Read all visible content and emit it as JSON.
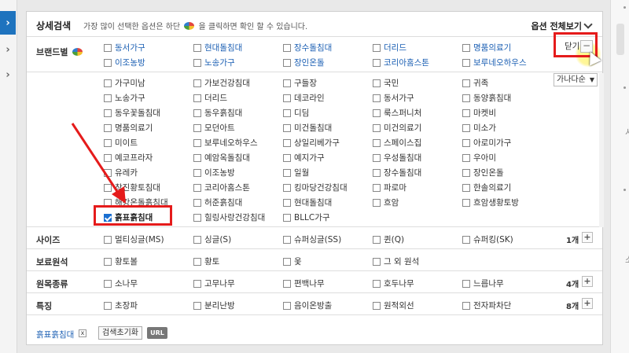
{
  "left_tabs": [
    "›",
    "›",
    "›"
  ],
  "right_strip": {
    "chars": [
      "시",
      "소"
    ]
  },
  "header": {
    "title": "상세검색",
    "desc_before": "가장 많이 선택한 옵션은 하단",
    "desc_after": "을 클릭하면 확인 할 수 있습니다.",
    "options_all": "옵션 전체보기"
  },
  "brand": {
    "label": "브랜드별",
    "favorites": [
      "동서가구",
      "현대돌침대",
      "장수돌침대",
      "더리드",
      "명품의료기",
      "이조농방",
      "노송가구",
      "장인온돌",
      "코리아홈스톤",
      "보루네오하우스"
    ],
    "close_label": "닫기",
    "minus": "−",
    "sort": "가나다순",
    "sort_arrow": "▼",
    "all": [
      [
        "가구미남",
        "가보건강침대",
        "구들장",
        "국민",
        "귀족"
      ],
      [
        "노송가구",
        "더리드",
        "데코라인",
        "동서가구",
        "동양흙침대"
      ],
      [
        "동우꽃돌침대",
        "동우흙침대",
        "디딤",
        "룩스퍼니처",
        "마켓비"
      ],
      [
        "명품의료기",
        "모던아트",
        "미건돌침대",
        "미건의료기",
        "미소가"
      ],
      [
        "미이트",
        "보루네오하우스",
        "상일리베가구",
        "스페이스집",
        "아로미가구"
      ],
      [
        "예코프라자",
        "예암옥돌침대",
        "예지가구",
        "우성돌침대",
        "우아미"
      ],
      [
        "유레카",
        "이조농방",
        "일월",
        "장수돌침대",
        "장인온돌"
      ],
      [
        "참진황토침대",
        "코리아홈스톤",
        "킹마당건강침대",
        "파로마",
        "한솔의료기"
      ],
      [
        "해강온돌흙침대",
        "허준흙침대",
        "현대돌침대",
        "흐암",
        "흐암생황토방"
      ],
      [
        "흙표흙침대",
        "힐링사랑건강침대",
        "BLLC가구",
        "",
        ""
      ]
    ],
    "checked": "흙표흙침대"
  },
  "sections": [
    {
      "label": "사이즈",
      "options": [
        "멀티싱글(MS)",
        "싱글(S)",
        "슈퍼싱글(SS)",
        "퀸(Q)",
        "슈퍼킹(SK)"
      ],
      "count": "1개",
      "plus": "+"
    },
    {
      "label": "보료원석",
      "options": [
        "황토볼",
        "황토",
        "옻",
        "그 외 원석"
      ],
      "count": "",
      "plus": ""
    },
    {
      "label": "원목종류",
      "options": [
        "소나무",
        "고무나무",
        "편백나무",
        "호두나무",
        "느릅나무"
      ],
      "count": "4개",
      "plus": "+"
    },
    {
      "label": "특징",
      "options": [
        "초장파",
        "분리난방",
        "음이온방출",
        "원적외선",
        "전자파차단"
      ],
      "count": "8개",
      "plus": "+"
    }
  ],
  "footer": {
    "chip": "흙표흙침대",
    "chip_x": "x",
    "reset": "검색초기화",
    "url": "URL"
  },
  "colors": {
    "accent_blue": "#1b5fb3",
    "annotation_red": "#e51b1b",
    "tab_blue": "#1e73be"
  },
  "icons": [
    "chevron-right-icon",
    "pie-chart-icon",
    "chevron-down-icon",
    "minus-icon",
    "plus-icon",
    "close-icon",
    "mouse-cursor-icon",
    "red-arrow-annotation"
  ]
}
